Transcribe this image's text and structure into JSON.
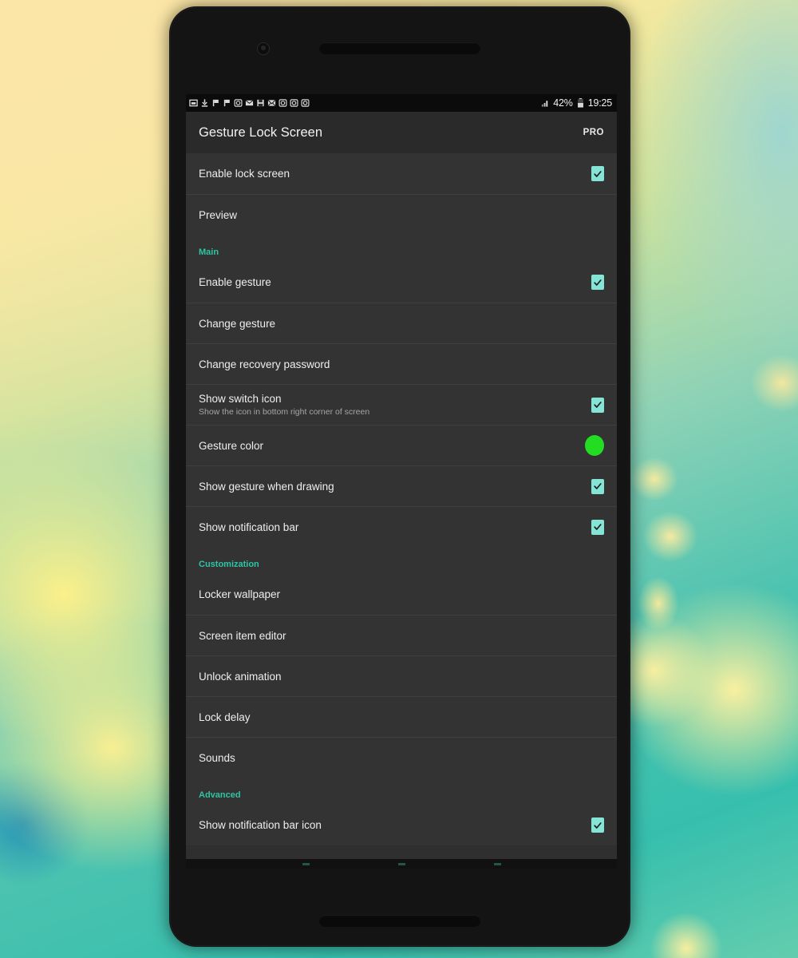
{
  "device": {
    "front_camera": "front-camera",
    "earpiece": "earpiece-speaker"
  },
  "status_bar": {
    "notification_icons": [
      "screenshot-icon",
      "download-icon",
      "flag-icon",
      "flag-icon",
      "camera-icon",
      "mail-icon",
      "save-icon",
      "message-icon",
      "camera-icon",
      "camera-icon",
      "camera-icon"
    ],
    "signal_icon": "signal-bars-icon",
    "battery_percent": "42%",
    "battery_icon": "battery-icon",
    "clock": "19:25"
  },
  "app_bar": {
    "title": "Gesture Lock Screen",
    "pro_label": "PRO"
  },
  "colors": {
    "accent_teal": "#2ec4a6",
    "checkbox_fill": "#84e5d6",
    "gesture_color_swatch": "#22dd22",
    "list_background": "#333333",
    "app_bar_background": "#2a2a2a",
    "status_bar_background": "#0b0b0b"
  },
  "settings": [
    {
      "type": "checkbox",
      "name": "enable-lock-screen",
      "title": "Enable lock screen",
      "summary": null,
      "checked": true,
      "divided": false
    },
    {
      "type": "action",
      "name": "preview",
      "title": "Preview",
      "summary": null,
      "divided": true
    },
    {
      "type": "section",
      "name": "section-main",
      "title": "Main"
    },
    {
      "type": "checkbox",
      "name": "enable-gesture",
      "title": "Enable gesture",
      "summary": null,
      "checked": true,
      "divided": false
    },
    {
      "type": "action",
      "name": "change-gesture",
      "title": "Change gesture",
      "summary": null,
      "divided": true
    },
    {
      "type": "action",
      "name": "change-recovery-password",
      "title": "Change recovery password",
      "summary": null,
      "divided": true
    },
    {
      "type": "checkbox",
      "name": "show-switch-icon",
      "title": "Show switch icon",
      "summary": "Show the icon in bottom right corner of screen",
      "checked": true,
      "divided": true
    },
    {
      "type": "color",
      "name": "gesture-color",
      "title": "Gesture color",
      "summary": null,
      "value": "#22dd22",
      "divided": true
    },
    {
      "type": "checkbox",
      "name": "show-gesture-when-drawing",
      "title": "Show gesture when drawing",
      "summary": null,
      "checked": true,
      "divided": true
    },
    {
      "type": "checkbox",
      "name": "show-notification-bar",
      "title": "Show notification bar",
      "summary": null,
      "checked": true,
      "divided": true
    },
    {
      "type": "section",
      "name": "section-customization",
      "title": "Customization"
    },
    {
      "type": "action",
      "name": "locker-wallpaper",
      "title": "Locker wallpaper",
      "summary": null,
      "divided": false
    },
    {
      "type": "action",
      "name": "screen-item-editor",
      "title": "Screen item editor",
      "summary": null,
      "divided": true
    },
    {
      "type": "action",
      "name": "unlock-animation",
      "title": "Unlock animation",
      "summary": null,
      "divided": true
    },
    {
      "type": "action",
      "name": "lock-delay",
      "title": "Lock delay",
      "summary": null,
      "divided": true
    },
    {
      "type": "action",
      "name": "sounds",
      "title": "Sounds",
      "summary": null,
      "divided": true
    },
    {
      "type": "section",
      "name": "section-advanced",
      "title": "Advanced"
    },
    {
      "type": "checkbox",
      "name": "show-notification-bar-icon",
      "title": "Show notification bar icon",
      "summary": null,
      "checked": true,
      "divided": false
    }
  ]
}
